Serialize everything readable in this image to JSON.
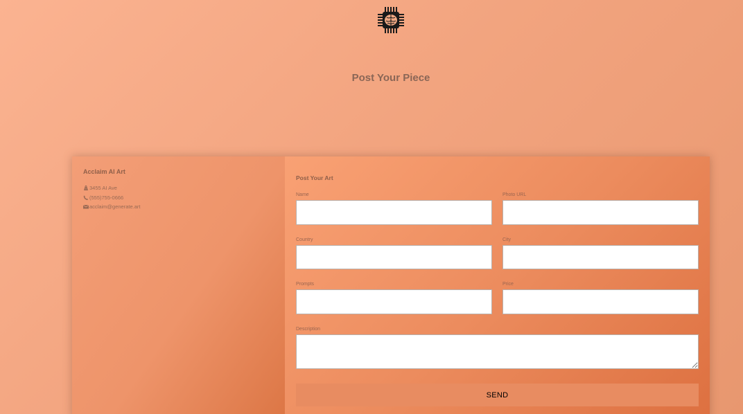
{
  "header": {
    "logo_icon": "brain-chip-icon",
    "heading": "Post Your Piece"
  },
  "contact": {
    "name": "Acclaim AI Art",
    "address": "3455 AI Ave",
    "phone": "(555)755-0666",
    "email": "acclaim@generate.art",
    "address_icon": "road-icon",
    "phone_icon": "phone-icon",
    "email_icon": "envelope-icon"
  },
  "form": {
    "title": "Post Your Art",
    "fields": {
      "name": {
        "label": "Name",
        "value": ""
      },
      "photo_url": {
        "label": "Photo URL",
        "value": ""
      },
      "country": {
        "label": "Country",
        "value": ""
      },
      "city": {
        "label": "City",
        "value": ""
      },
      "prompts": {
        "label": "Prompts",
        "value": ""
      },
      "price": {
        "label": "Price",
        "value": ""
      },
      "description": {
        "label": "Description",
        "value": ""
      }
    },
    "submit_label": "SEND"
  },
  "colors": {
    "background": "#f2a47f",
    "form_panel": "#ec8c5e",
    "send_button": "#e88c61",
    "text_muted": "#8f5f49"
  }
}
